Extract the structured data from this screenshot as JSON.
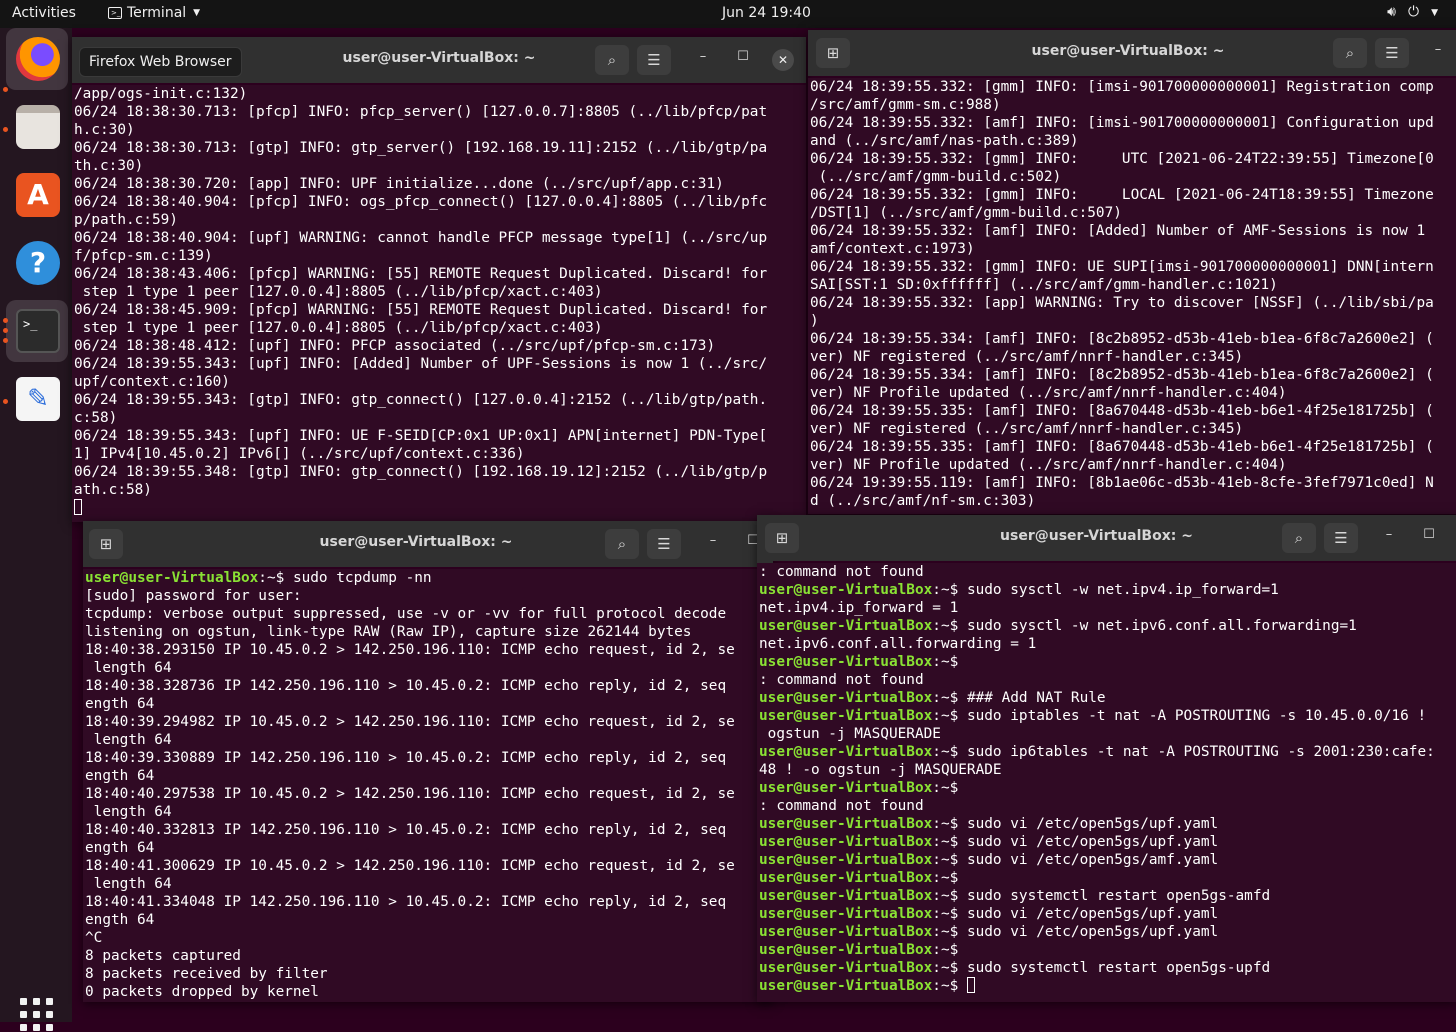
{
  "topbar": {
    "activities": "Activities",
    "app_name": "Terminal",
    "clock": "Jun 24  19:40",
    "volume_icon": "volume-icon",
    "power_icon": "power-icon"
  },
  "dock": {
    "items": [
      "firefox",
      "files",
      "software",
      "help",
      "terminal",
      "text-editor"
    ],
    "grid_icon": "show-applications-icon"
  },
  "tooltip": "Firefox Web Browser",
  "colors": {
    "terminal_bg": "#300a24",
    "prompt_green": "#8ae234",
    "accent": "#e95420",
    "titlebar": "#303030"
  },
  "win_tl": {
    "title": "user@user-VirtualBox: ~",
    "lines": [
      "/app/ogs-init.c:132)",
      "06/24 18:38:30.713: [pfcp] INFO: pfcp_server() [127.0.0.7]:8805 (../lib/pfcp/pat",
      "h.c:30)",
      "06/24 18:38:30.713: [gtp] INFO: gtp_server() [192.168.19.11]:2152 (../lib/gtp/pa",
      "th.c:30)",
      "06/24 18:38:30.720: [app] INFO: UPF initialize...done (../src/upf/app.c:31)",
      "06/24 18:38:40.904: [pfcp] INFO: ogs_pfcp_connect() [127.0.0.4]:8805 (../lib/pfc",
      "p/path.c:59)",
      "06/24 18:38:40.904: [upf] WARNING: cannot handle PFCP message type[1] (../src/up",
      "f/pfcp-sm.c:139)",
      "06/24 18:38:43.406: [pfcp] WARNING: [55] REMOTE Request Duplicated. Discard! for",
      " step 1 type 1 peer [127.0.0.4]:8805 (../lib/pfcp/xact.c:403)",
      "06/24 18:38:45.909: [pfcp] WARNING: [55] REMOTE Request Duplicated. Discard! for",
      " step 1 type 1 peer [127.0.0.4]:8805 (../lib/pfcp/xact.c:403)",
      "06/24 18:38:48.412: [upf] INFO: PFCP associated (../src/upf/pfcp-sm.c:173)",
      "06/24 18:39:55.343: [upf] INFO: [Added] Number of UPF-Sessions is now 1 (../src/",
      "upf/context.c:160)",
      "06/24 18:39:55.343: [gtp] INFO: gtp_connect() [127.0.0.4]:2152 (../lib/gtp/path.",
      "c:58)",
      "06/24 18:39:55.343: [upf] INFO: UE F-SEID[CP:0x1 UP:0x1] APN[internet] PDN-Type[",
      "1] IPv4[10.45.0.2] IPv6[] (../src/upf/context.c:336)",
      "06/24 18:39:55.348: [gtp] INFO: gtp_connect() [192.168.19.12]:2152 (../lib/gtp/p",
      "ath.c:58)"
    ]
  },
  "win_tr": {
    "title": "user@user-VirtualBox: ~",
    "lines": [
      "06/24 18:39:55.332: [gmm] INFO: [imsi-901700000000001] Registration comp",
      "/src/amf/gmm-sm.c:988)",
      "06/24 18:39:55.332: [amf] INFO: [imsi-901700000000001] Configuration upd",
      "and (../src/amf/nas-path.c:389)",
      "06/24 18:39:55.332: [gmm] INFO:     UTC [2021-06-24T22:39:55] Timezone[0",
      " (../src/amf/gmm-build.c:502)",
      "06/24 18:39:55.332: [gmm] INFO:     LOCAL [2021-06-24T18:39:55] Timezone",
      "/DST[1] (../src/amf/gmm-build.c:507)",
      "06/24 18:39:55.332: [amf] INFO: [Added] Number of AMF-Sessions is now 1",
      "amf/context.c:1973)",
      "06/24 18:39:55.332: [gmm] INFO: UE SUPI[imsi-901700000000001] DNN[intern",
      "SAI[SST:1 SD:0xffffff] (../src/amf/gmm-handler.c:1021)",
      "06/24 18:39:55.332: [app] WARNING: Try to discover [NSSF] (../lib/sbi/pa",
      ")",
      "06/24 18:39:55.334: [amf] INFO: [8c2b8952-d53b-41eb-b1ea-6f8c7a2600e2] (",
      "ver) NF registered (../src/amf/nnrf-handler.c:345)",
      "06/24 18:39:55.334: [amf] INFO: [8c2b8952-d53b-41eb-b1ea-6f8c7a2600e2] (",
      "ver) NF Profile updated (../src/amf/nnrf-handler.c:404)",
      "06/24 18:39:55.335: [amf] INFO: [8a670448-d53b-41eb-b6e1-4f25e181725b] (",
      "ver) NF registered (../src/amf/nnrf-handler.c:345)",
      "06/24 18:39:55.335: [amf] INFO: [8a670448-d53b-41eb-b6e1-4f25e181725b] (",
      "ver) NF Profile updated (../src/amf/nnrf-handler.c:404)",
      "06/24 19:39:55.119: [amf] INFO: [8b1ae06c-d53b-41eb-8cfe-3fef7971c0ed] N",
      "d (../src/amf/nf-sm.c:303)"
    ]
  },
  "win_bl": {
    "title": "user@user-VirtualBox: ~",
    "prompt_user": "user@user-VirtualBox",
    "prompt_tail": ":~$ ",
    "command": "sudo tcpdump -nn",
    "lines": [
      "[sudo] password for user:",
      "tcpdump: verbose output suppressed, use -v or -vv for full protocol decode",
      "listening on ogstun, link-type RAW (Raw IP), capture size 262144 bytes",
      "18:40:38.293150 IP 10.45.0.2 > 142.250.196.110: ICMP echo request, id 2, se",
      " length 64",
      "18:40:38.328736 IP 142.250.196.110 > 10.45.0.2: ICMP echo reply, id 2, seq",
      "ength 64",
      "18:40:39.294982 IP 10.45.0.2 > 142.250.196.110: ICMP echo request, id 2, se",
      " length 64",
      "18:40:39.330889 IP 142.250.196.110 > 10.45.0.2: ICMP echo reply, id 2, seq",
      "ength 64",
      "18:40:40.297538 IP 10.45.0.2 > 142.250.196.110: ICMP echo request, id 2, se",
      " length 64",
      "18:40:40.332813 IP 142.250.196.110 > 10.45.0.2: ICMP echo reply, id 2, seq",
      "ength 64",
      "18:40:41.300629 IP 10.45.0.2 > 142.250.196.110: ICMP echo request, id 2, se",
      " length 64",
      "18:40:41.334048 IP 142.250.196.110 > 10.45.0.2: ICMP echo reply, id 2, seq",
      "ength 64",
      "^C",
      "8 packets captured",
      "8 packets received by filter",
      "0 packets dropped by kernel"
    ]
  },
  "win_br": {
    "title": "user@user-VirtualBox: ~",
    "prompt_user": "user@user-VirtualBox",
    "prompt_tail": ":~$ ",
    "lines": [
      {
        "p": false,
        "t": ": command not found"
      },
      {
        "p": true,
        "t": "sudo sysctl -w net.ipv4.ip_forward=1"
      },
      {
        "p": false,
        "t": "net.ipv4.ip_forward = 1"
      },
      {
        "p": true,
        "t": "sudo sysctl -w net.ipv6.conf.all.forwarding=1"
      },
      {
        "p": false,
        "t": "net.ipv6.conf.all.forwarding = 1"
      },
      {
        "p": true,
        "t": ""
      },
      {
        "p": false,
        "t": ": command not found"
      },
      {
        "p": true,
        "t": "### Add NAT Rule"
      },
      {
        "p": true,
        "t": "sudo iptables -t nat -A POSTROUTING -s 10.45.0.0/16 !"
      },
      {
        "p": false,
        "t": " ogstun -j MASQUERADE"
      },
      {
        "p": true,
        "t": "sudo ip6tables -t nat -A POSTROUTING -s 2001:230:cafe:"
      },
      {
        "p": false,
        "t": "48 ! -o ogstun -j MASQUERADE"
      },
      {
        "p": true,
        "t": ""
      },
      {
        "p": false,
        "t": ": command not found"
      },
      {
        "p": true,
        "t": "sudo vi /etc/open5gs/upf.yaml"
      },
      {
        "p": true,
        "t": "sudo vi /etc/open5gs/upf.yaml"
      },
      {
        "p": true,
        "t": "sudo vi /etc/open5gs/amf.yaml"
      },
      {
        "p": true,
        "t": ""
      },
      {
        "p": true,
        "t": "sudo systemctl restart open5gs-amfd"
      },
      {
        "p": true,
        "t": "sudo vi /etc/open5gs/upf.yaml"
      },
      {
        "p": true,
        "t": "sudo vi /etc/open5gs/upf.yaml"
      },
      {
        "p": true,
        "t": ""
      },
      {
        "p": true,
        "t": "sudo systemctl restart open5gs-upfd"
      },
      {
        "p": true,
        "t": "",
        "cursor": true
      }
    ]
  }
}
